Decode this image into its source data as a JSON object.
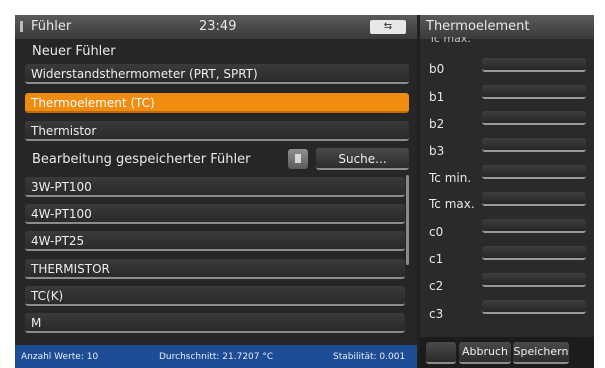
{
  "left_panel": {
    "title": "Fühler",
    "time": "23:49",
    "usb_icon": "usb-icon",
    "new_sensor_label": "Neuer Fühler",
    "sensor_types": [
      {
        "label": "Widerstandsthermometer (PRT, SPRT)",
        "selected": false
      },
      {
        "label": "Thermoelement (TC)",
        "selected": true
      },
      {
        "label": "Thermistor",
        "selected": false
      }
    ],
    "edit_saved_label": "Bearbeitung gespeicherter Fühler",
    "delete_icon": "trash-icon",
    "search_label": "Suche...",
    "saved_sensors": [
      "3W-PT100",
      "4W-PT100",
      "4W-PT25",
      "THERMISTOR",
      "TC(K)",
      "M"
    ],
    "status": {
      "count": "Anzahl Werte: 10",
      "average": "Durchschnitt: 21.7207 °C",
      "stability": "Stabilität: 0.001"
    }
  },
  "right_panel": {
    "title": "Thermoelement",
    "cut_label": "Tc max.",
    "parameters": [
      {
        "label": "b0",
        "value": ""
      },
      {
        "label": "b1",
        "value": ""
      },
      {
        "label": "b2",
        "value": ""
      },
      {
        "label": "b3",
        "value": ""
      },
      {
        "label": "Tc min.",
        "value": ""
      },
      {
        "label": "Tc max.",
        "value": ""
      },
      {
        "label": "c0",
        "value": ""
      },
      {
        "label": "c1",
        "value": ""
      },
      {
        "label": "c2",
        "value": ""
      },
      {
        "label": "c3",
        "value": ""
      }
    ],
    "cancel_label": "Abbruch",
    "save_label": "Speichern"
  },
  "colors": {
    "selected": "#f08c10",
    "status_bar": "#1e4d96",
    "background": "#262626"
  }
}
